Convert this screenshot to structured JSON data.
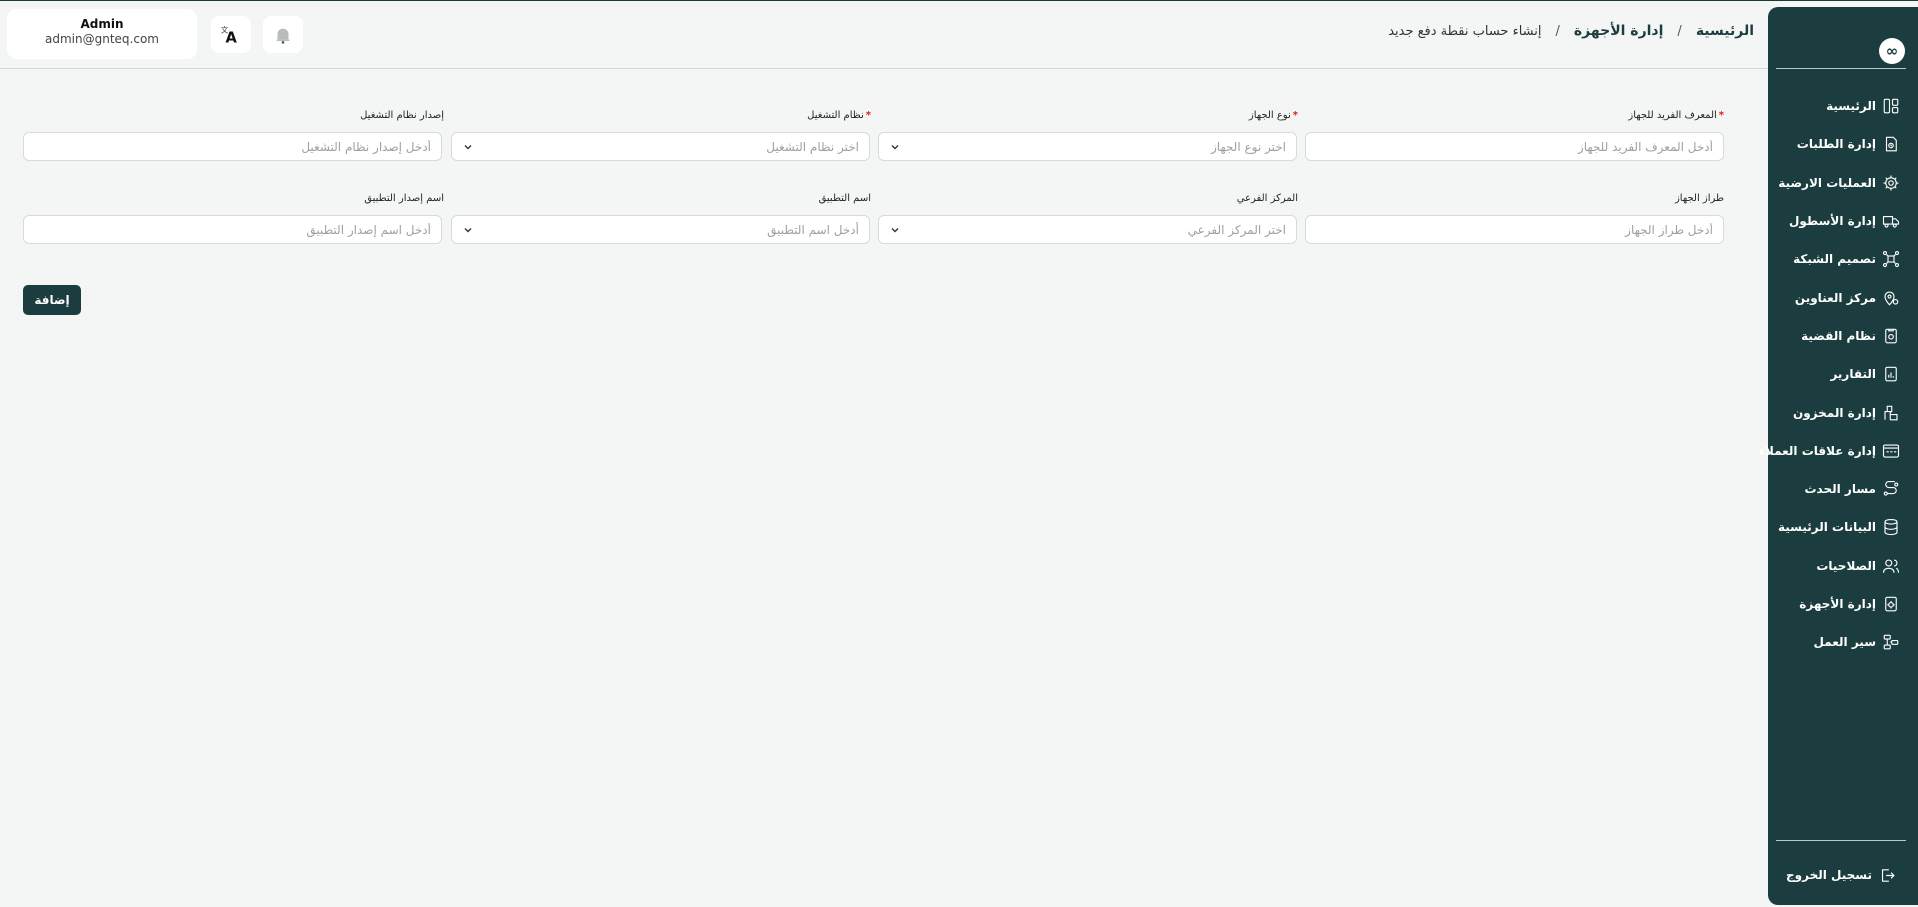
{
  "header": {
    "breadcrumb": {
      "home": "الرئيسية",
      "section": "إدارة الأجهزة",
      "separator": "/",
      "current": "إنشاء حساب نقطة دفع جديد"
    },
    "user": {
      "name": "Admin",
      "email": "admin@gnteq.com"
    },
    "language_icon": "translate-icon",
    "notification_icon": "bell-icon"
  },
  "sidebar": {
    "logo": "∞",
    "items": [
      {
        "label": "الرئيسية",
        "icon": "dashboard-icon"
      },
      {
        "label": "إدارة الطلبات",
        "icon": "orders-icon"
      },
      {
        "label": "العمليات الارضية",
        "icon": "gear-icon"
      },
      {
        "label": "إدارة الأسطول",
        "icon": "truck-icon"
      },
      {
        "label": "تصميم الشبكة",
        "icon": "network-icon"
      },
      {
        "label": "مركز العناوين",
        "icon": "location-icon"
      },
      {
        "label": "نظام القضية",
        "icon": "case-icon"
      },
      {
        "label": "التقارير",
        "icon": "report-icon"
      },
      {
        "label": "إدارة المخزون",
        "icon": "inventory-icon"
      },
      {
        "label": "إدارة علاقات العملاء",
        "icon": "crm-icon"
      },
      {
        "label": "مسار الحدث",
        "icon": "route-icon"
      },
      {
        "label": "البيانات الرئيسية",
        "icon": "database-icon"
      },
      {
        "label": "الصلاحيات",
        "icon": "users-icon"
      },
      {
        "label": "إدارة الأجهزة",
        "icon": "device-icon"
      },
      {
        "label": "سير العمل",
        "icon": "workflow-icon"
      }
    ],
    "logout": "تسجيل الخروج"
  },
  "form": {
    "device_id": {
      "label": "المعرف الفريد للجهاز",
      "required": true,
      "placeholder": "أدخل المعرف الفريد للجهاز"
    },
    "device_type": {
      "label": "نوع الجهاز",
      "required": true,
      "placeholder": "اختر نوع الجهاز"
    },
    "os": {
      "label": "نظام التشغيل",
      "required": true,
      "placeholder": "اختر نظام التشغيل"
    },
    "os_version": {
      "label": "إصدار نظام التشغيل",
      "required": false,
      "placeholder": "أدخل إصدار نظام التشغيل"
    },
    "device_model": {
      "label": "طراز الجهاز",
      "required": false,
      "placeholder": "أدخل طراز الجهاز"
    },
    "branch": {
      "label": "المركز الفرعي",
      "required": false,
      "placeholder": "اختر المركز الفرعي"
    },
    "app_name": {
      "label": "اسم التطبيق",
      "required": false,
      "placeholder": "أدخل اسم التطبيق"
    },
    "app_version_name": {
      "label": "اسم إصدار التطبيق",
      "required": false,
      "placeholder": "أدخل اسم إصدار التطبيق"
    },
    "required_mark": "*",
    "submit": "إضافة"
  }
}
